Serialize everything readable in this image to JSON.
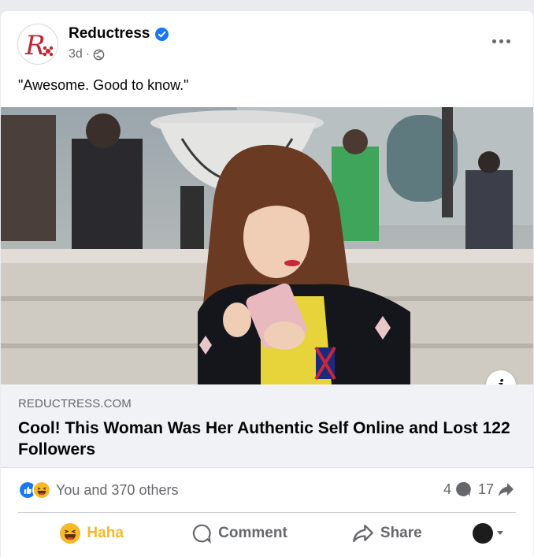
{
  "post": {
    "page_name": "Reductress",
    "time_ago": "3d",
    "meta_separator": "·",
    "caption": "\"Awesome. Good to know.\""
  },
  "link_preview": {
    "domain": "REDUCTRESS.COM",
    "title": "Cool! This Woman Was Her Authentic Self Online and Lost 122 Followers"
  },
  "reactions": {
    "summary": "You and 370 others",
    "comments_count": "4",
    "shares_count": "17"
  },
  "actions": {
    "haha_label": "Haha",
    "comment_label": "Comment",
    "share_label": "Share"
  },
  "colors": {
    "brand_red": "#c1272d",
    "verified_blue": "#1877f2",
    "haha_yellow": "#f7b928",
    "secondary_text": "#65676b"
  },
  "icons": {
    "logo": "reductress-logo-icon",
    "verified": "verified-badge-icon",
    "audience": "globe-icon",
    "more": "more-options-icon",
    "info": "info-icon",
    "like_reaction": "like-reaction-icon",
    "haha_reaction": "haha-reaction-icon",
    "comment": "comment-icon",
    "share": "share-icon"
  }
}
